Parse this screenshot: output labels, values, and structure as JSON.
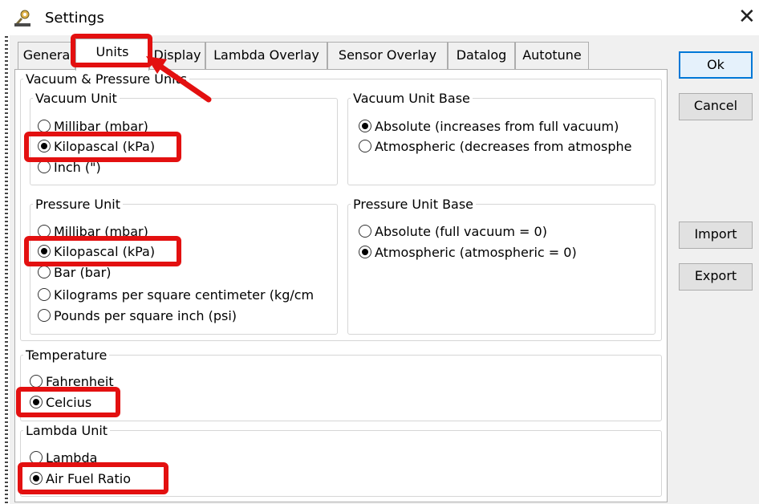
{
  "window": {
    "title": "Settings",
    "close_glyph": "✕"
  },
  "tabs": [
    "Genera",
    "Units",
    "Display",
    "Lambda Overlay",
    "Sensor Overlay",
    "Datalog",
    "Autotune"
  ],
  "vacuum_pressure_group": {
    "legend": "Vacuum & Pressure Units"
  },
  "vacuum_unit": {
    "legend": "Vacuum Unit",
    "options": [
      "Millibar (mbar)",
      "Kilopascal (kPa)",
      "Inch (\")"
    ],
    "selected": 1
  },
  "vacuum_unit_base": {
    "legend": "Vacuum Unit Base",
    "options": [
      "Absolute (increases from full vacuum)",
      "Atmospheric (decreases from atmosphe"
    ],
    "selected": 0
  },
  "pressure_unit": {
    "legend": "Pressure Unit",
    "options": [
      "Millibar (mbar)",
      "Kilopascal (kPa)",
      "Bar (bar)",
      "Kilograms per square centimeter (kg/cm",
      "Pounds per square inch (psi)"
    ],
    "selected": 1
  },
  "pressure_unit_base": {
    "legend": "Pressure Unit Base",
    "options": [
      "Absolute (full vacuum = 0)",
      "Atmospheric (atmospheric = 0)"
    ],
    "selected": 1
  },
  "temperature": {
    "legend": "Temperature",
    "options": [
      "Fahrenheit",
      "Celcius"
    ],
    "selected": 1
  },
  "lambda_unit": {
    "legend": "Lambda Unit",
    "options": [
      "Lambda",
      "Air Fuel Ratio"
    ],
    "selected": 1
  },
  "buttons": {
    "ok": "Ok",
    "cancel": "Cancel",
    "import": "Import",
    "export": "Export"
  },
  "annotation_color": "#e31010",
  "icons": {
    "app": "settings-app-icon",
    "close": "close-icon"
  }
}
